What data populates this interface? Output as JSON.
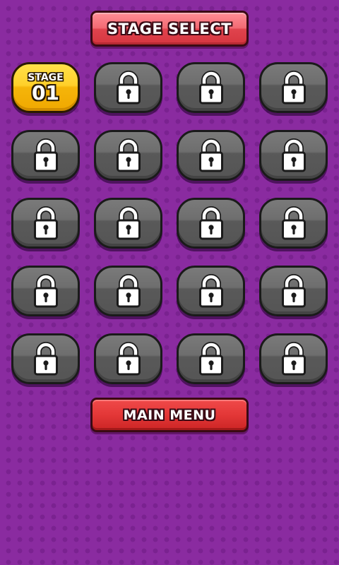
{
  "header": {
    "title": "STAGE SELECT"
  },
  "stages": [
    {
      "label": "STAGE",
      "number": "01",
      "locked": false
    },
    {
      "locked": true
    },
    {
      "locked": true
    },
    {
      "locked": true
    },
    {
      "locked": true
    },
    {
      "locked": true
    },
    {
      "locked": true
    },
    {
      "locked": true
    },
    {
      "locked": true
    },
    {
      "locked": true
    },
    {
      "locked": true
    },
    {
      "locked": true
    },
    {
      "locked": true
    },
    {
      "locked": true
    },
    {
      "locked": true
    },
    {
      "locked": true
    },
    {
      "locked": true
    },
    {
      "locked": true
    },
    {
      "locked": true
    },
    {
      "locked": true
    }
  ],
  "icons": {
    "locked_stage": "lock-icon"
  },
  "footer": {
    "main_menu_label": "MAIN MENU"
  },
  "colors": {
    "background": "#8a2ba0",
    "title_banner": "#f26a73",
    "menu_button": "#e33737",
    "unlocked_tile": "#ffd02a",
    "locked_tile": "#6e6e6e"
  }
}
